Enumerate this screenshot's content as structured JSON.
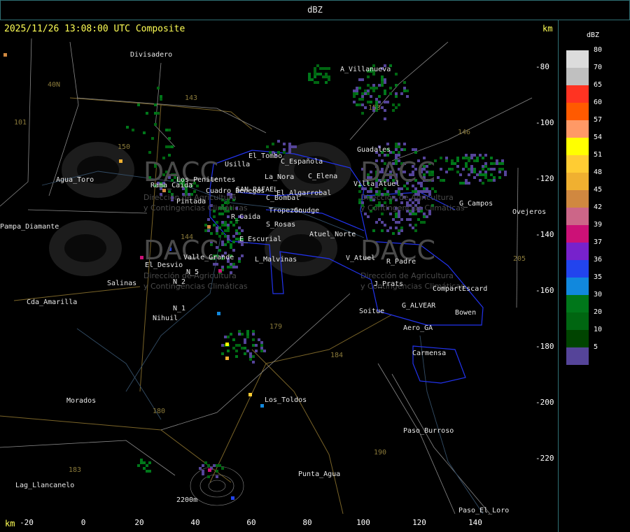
{
  "title": "dBZ",
  "timestamp": "2025/11/26 13:08:00 UTC Composite",
  "axis_unit": "km",
  "legend": {
    "title": "dBZ",
    "items": [
      {
        "label": "80",
        "color": "#dcdcdc"
      },
      {
        "label": "70",
        "color": "#c0c0c0"
      },
      {
        "label": "65",
        "color": "#ff3322"
      },
      {
        "label": "60",
        "color": "#ff5a00"
      },
      {
        "label": "57",
        "color": "#ff9966"
      },
      {
        "label": "54",
        "color": "#ffff00"
      },
      {
        "label": "51",
        "color": "#ffcc33"
      },
      {
        "label": "48",
        "color": "#f0b030"
      },
      {
        "label": "45",
        "color": "#d08840"
      },
      {
        "label": "42",
        "color": "#cc6688"
      },
      {
        "label": "39",
        "color": "#cc1177"
      },
      {
        "label": "37",
        "color": "#7722cc"
      },
      {
        "label": "36",
        "color": "#2244ee"
      },
      {
        "label": "35",
        "color": "#1188dd"
      },
      {
        "label": "30",
        "color": "#00771a"
      },
      {
        "label": "20",
        "color": "#006611"
      },
      {
        "label": "10",
        "color": "#004400"
      },
      {
        "label": "5",
        "color": "#554499"
      }
    ]
  },
  "y_ticks": [
    "-80",
    "-100",
    "-120",
    "-140",
    "-160",
    "-180",
    "-200",
    "-220"
  ],
  "x_ticks": [
    "-20",
    "0",
    "20",
    "40",
    "60",
    "80",
    "100",
    "120",
    "140"
  ],
  "watermark": {
    "brand": "DACC",
    "line1": "Dirección de Agricultura",
    "line2": "y Contingencias Climáticas"
  },
  "places": [
    "Divisadero",
    "A_Villanueva",
    "Guadales",
    "Agua_Toro",
    "Pampa_Diamante",
    "Usilla",
    "El_Tombo",
    "C_Española",
    "La_Nora",
    "C_Elena",
    "Los_Penitentes",
    "Villa_Atuel",
    "El_Algarrobal",
    "SAN_RAFAEL",
    "C_Bombal",
    "S_Rosas",
    "Tropezon",
    "Goudge",
    "Atuel_Norte",
    "R_Caida",
    "E_Escurial",
    "L_Malvinas",
    "V_Atuel",
    "R_Padre",
    "J_Prats",
    "CompartEscard",
    "G_ALVEAR",
    "Bowen",
    "Soitue",
    "Aero_GA",
    "Carmensa",
    "El_Desvio",
    "Valle_Grande",
    "Salinas",
    "N_2",
    "N_5",
    "N_1",
    "Nihuil",
    "Cda_Amarilla",
    "Morados",
    "Los_Toldos",
    "Paso_Burroso",
    "Punta_Agua",
    "Lag_Llancanelo",
    "2200m",
    "Paso_El_Loro",
    "G_Campos",
    "Ovejeros",
    "Pintada",
    "Cuadro_Benegas",
    "Rama_Caida"
  ],
  "routes": [
    "143",
    "150",
    "153",
    "146",
    "40N",
    "101",
    "144",
    "179",
    "184",
    "180",
    "183",
    "190",
    "205"
  ]
}
